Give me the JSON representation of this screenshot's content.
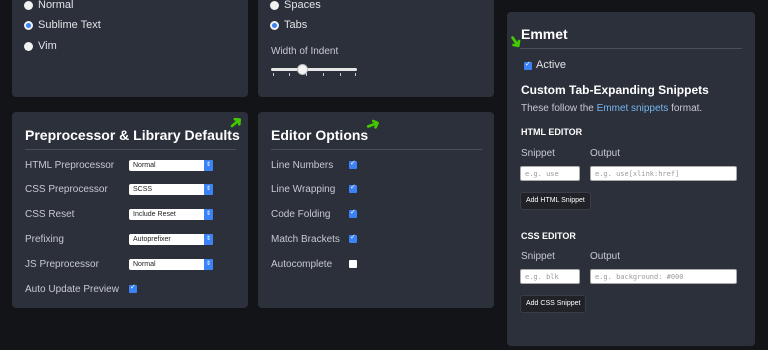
{
  "keybindings": {
    "options": [
      {
        "label": "Normal",
        "selected": false
      },
      {
        "label": "Sublime Text",
        "selected": true
      },
      {
        "label": "Vim",
        "selected": false
      }
    ]
  },
  "indentation": {
    "options": [
      {
        "label": "Spaces",
        "selected": false
      },
      {
        "label": "Tabs",
        "selected": true
      }
    ],
    "width_label": "Width of Indent"
  },
  "preprocessor": {
    "title": "Preprocessor & Library Defaults",
    "rows": [
      {
        "label": "HTML Preprocessor",
        "value": "Normal"
      },
      {
        "label": "CSS Preprocessor",
        "value": "SCSS"
      },
      {
        "label": "CSS Reset",
        "value": "Include Reset"
      },
      {
        "label": "Prefixing",
        "value": "Autoprefixer"
      },
      {
        "label": "JS Preprocessor",
        "value": "Normal"
      }
    ],
    "auto_update": {
      "label": "Auto Update Preview",
      "checked": true
    }
  },
  "editor": {
    "title": "Editor Options",
    "rows": [
      {
        "label": "Line Numbers",
        "checked": true
      },
      {
        "label": "Line Wrapping",
        "checked": true
      },
      {
        "label": "Code Folding",
        "checked": true
      },
      {
        "label": "Match Brackets",
        "checked": true
      },
      {
        "label": "Autocomplete",
        "checked": false
      }
    ]
  },
  "emmet": {
    "title": "Emmet",
    "active_label": "Active",
    "active": true,
    "subtitle": "Custom Tab-Expanding Snippets",
    "desc_prefix": "These follow the ",
    "desc_link": "Emmet snippets",
    "desc_suffix": " format.",
    "html_editor": {
      "heading": "HTML EDITOR",
      "snippet_label": "Snippet",
      "output_label": "Output",
      "snippet_placeholder": "e.g. use",
      "output_placeholder": "e.g. use[xlink:href]",
      "button": "Add HTML Snippet"
    },
    "css_editor": {
      "heading": "CSS EDITOR",
      "snippet_label": "Snippet",
      "output_label": "Output",
      "snippet_placeholder": "e.g. blk",
      "output_placeholder": "e.g. background: #000",
      "button": "Add CSS Snippet"
    }
  },
  "colors": {
    "accent": "#3b82f6",
    "annotation_arrow": "#42c900",
    "panel": "#2c303a",
    "background": "#131417"
  }
}
